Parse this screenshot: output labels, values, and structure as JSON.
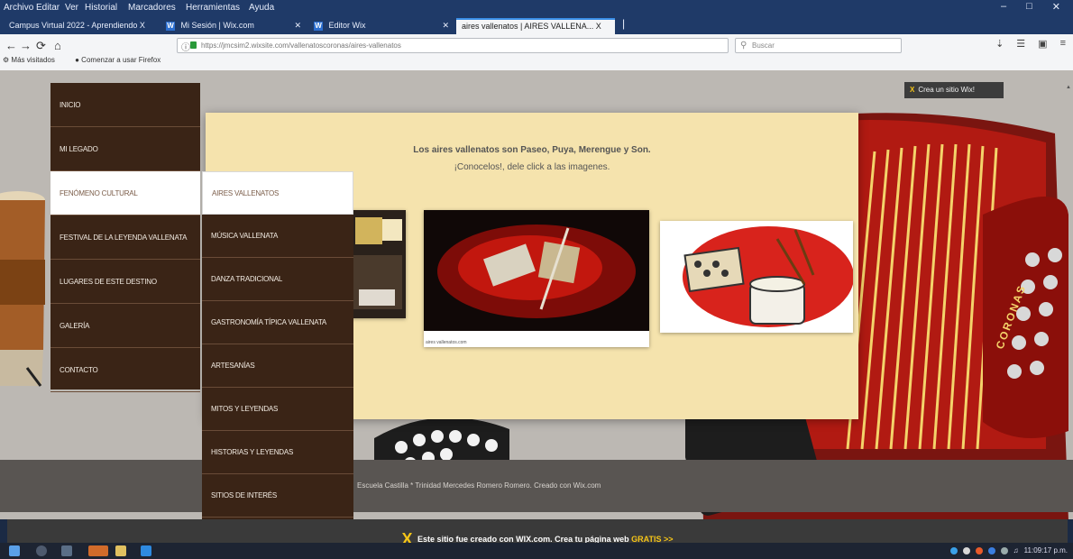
{
  "menubar": {
    "items": [
      "Archivo",
      "Editar",
      "Ver",
      "Historial",
      "Marcadores",
      "Herramientas",
      "Ayuda"
    ]
  },
  "tabs": [
    {
      "label": "Campus Virtual 2022 - Aprendiendo X",
      "active": false
    },
    {
      "label": "Mi Sesión | Wix.com",
      "active": false
    },
    {
      "label": "Editor Wix",
      "active": false
    },
    {
      "label": "aires vallenatos | AIRES VALLENA... X",
      "active": true
    }
  ],
  "navbar": {
    "url": "https://jmcsim2.wixsite.com/vallenatoscoronas/aires-vallenatos",
    "search_placeholder": "Buscar"
  },
  "bookmarks": [
    "Más visitados",
    "Comenzar a usar Firefox"
  ],
  "wix_badge": "Crea un sitio Wix!",
  "nav_menu": [
    {
      "label": "INICIO",
      "active": false
    },
    {
      "label": "MI LEGADO",
      "active": false
    },
    {
      "label": "FENÓMENO CULTURAL",
      "active": true
    },
    {
      "label": "FESTIVAL DE LA LEYENDA VALLENATA",
      "active": false
    },
    {
      "label": "LUGARES DE ESTE DESTINO",
      "active": false
    },
    {
      "label": "GALERÍA",
      "active": false
    },
    {
      "label": "CONTACTO",
      "active": false
    }
  ],
  "sub_menu": [
    {
      "label": "AIRES VALLENATOS",
      "active": true
    },
    {
      "label": "MÚSICA VALLENATA",
      "active": false
    },
    {
      "label": "DANZA TRADICIONAL",
      "active": false
    },
    {
      "label": "GASTRONOMÍA TÍPICA VALLENATA",
      "active": false
    },
    {
      "label": "ARTESANÍAS",
      "active": false
    },
    {
      "label": "MITOS Y LEYENDAS",
      "active": false
    },
    {
      "label": "HISTORIAS Y LEYENDAS",
      "active": false
    },
    {
      "label": "SITIOS DE INTERÉS",
      "active": false
    }
  ],
  "content": {
    "headline": "Los aires vallenatos son Paseo, Puya, Merengue y Son.",
    "subhead": "¡Conocelos!, dele click a las imagenes.",
    "image_caption": "aires vallenatos.com"
  },
  "footer_text": "Escuela Castilla * Trinidad Mercedes Romero Romero. Creado con Wix.com",
  "accordion_brand": "CORONAS",
  "banner": {
    "text": "Este sitio fue creado con WIX.com. Crea tu página web",
    "cta": "GRATIS >>"
  },
  "tray": {
    "time": "11:09:17 p.m."
  },
  "colors": {
    "menu_bg": "#3a2416",
    "panel_bg": "#f5e3ad",
    "footer_bg": "#595552",
    "accordion_red": "#b11a12",
    "wix_yellow": "#f5c518"
  }
}
